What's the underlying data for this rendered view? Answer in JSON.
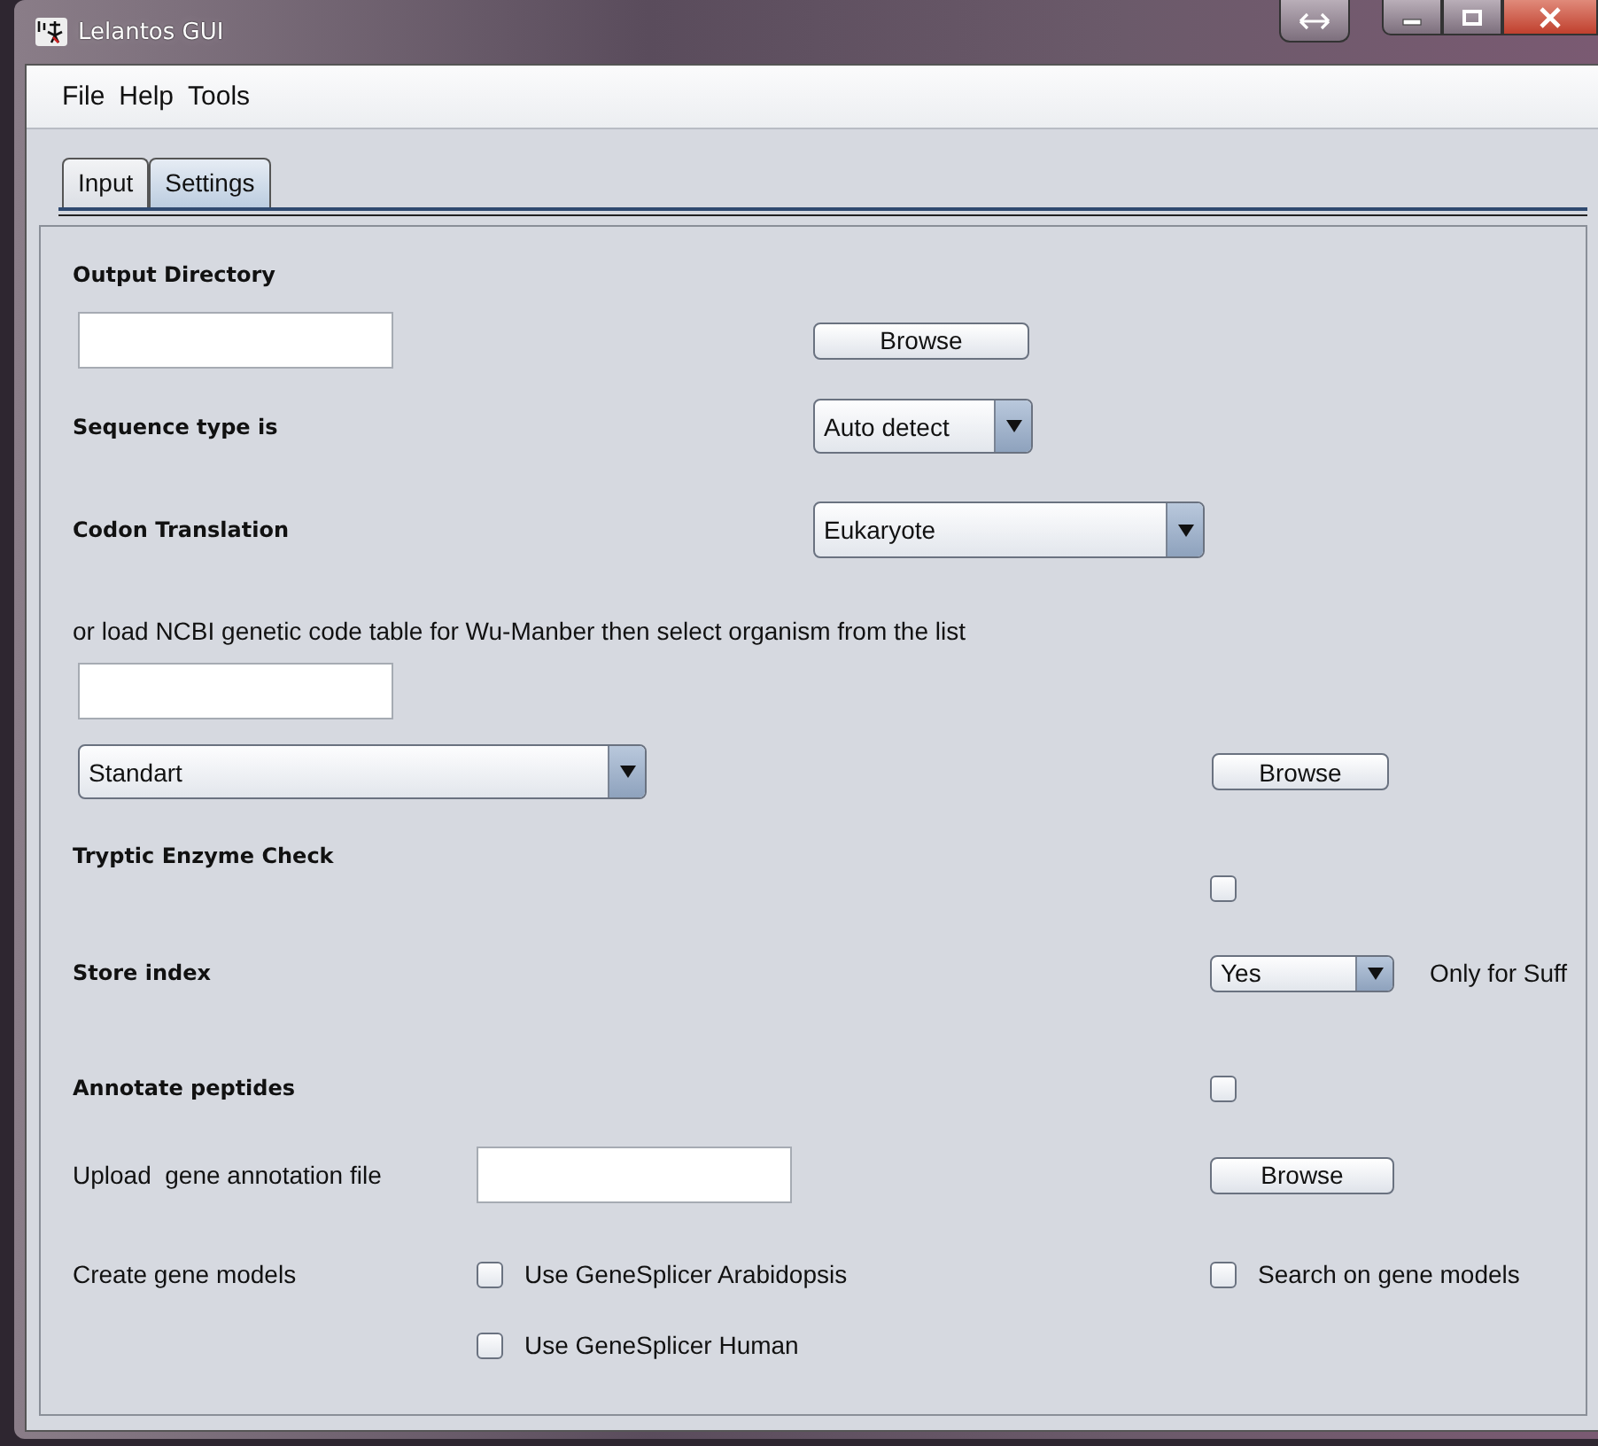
{
  "window": {
    "title": "Lelantos GUI"
  },
  "menu": [
    "File",
    "Help",
    "Tools"
  ],
  "tabs": [
    {
      "label": "Input",
      "selected": false
    },
    {
      "label": "Settings",
      "selected": true
    }
  ],
  "settings": {
    "output_directory": {
      "label": "Output Directory",
      "button": "Browse"
    },
    "sequence_type": {
      "label": "Sequence type is",
      "value": "Auto detect"
    },
    "codon_translation": {
      "label": "Codon Translation",
      "value": "Eukaryote"
    },
    "ncbi_table": {
      "label": "or load NCBI genetic code table for Wu-Manber then select organism from the list",
      "organism": "Standart",
      "button": "Browse"
    },
    "tryptic_enzyme_check": {
      "label": "Tryptic Enzyme Check",
      "checked": false
    },
    "store_index": {
      "label": "Store index",
      "value": "Yes",
      "note": "Only for Suff"
    },
    "annotate_peptides": {
      "label": "Annotate peptides",
      "checked": false
    },
    "gene_annotation_file": {
      "label": "Upload  gene annotation file",
      "button": "Browse"
    },
    "gene_models": {
      "label": "Create gene models",
      "options": [
        {
          "label": "Use GeneSplicer Arabidopsis",
          "checked": false
        },
        {
          "label": "Use GeneSplicer Human",
          "checked": false
        }
      ],
      "search": {
        "label": "Search on gene models",
        "checked": false
      }
    }
  }
}
